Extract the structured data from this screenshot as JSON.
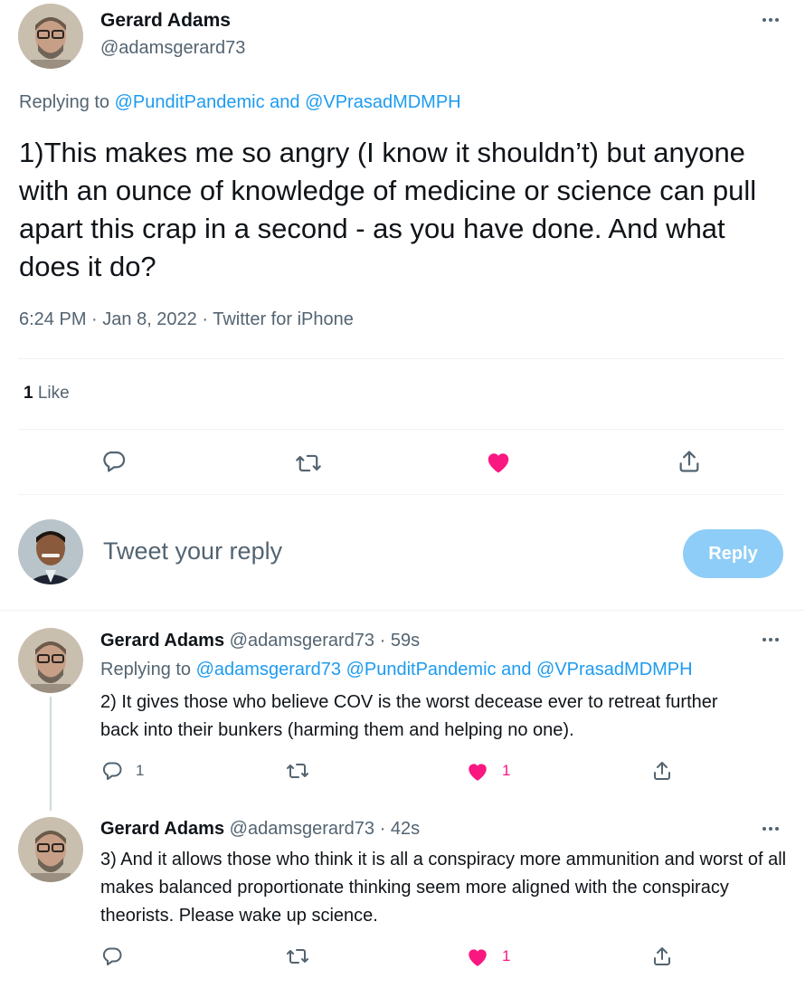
{
  "main_tweet": {
    "author_name": "Gerard Adams",
    "author_handle": "@adamsgerard73",
    "replying_prefix": "Replying to ",
    "replying_to_1": "@PunditPandemic",
    "replying_and": " and ",
    "replying_to_2": "@VPrasadMDMPH",
    "text": "1)This makes me so angry (I know it shouldn’t) but anyone with an ounce of knowledge of medicine or science can pull apart this crap in a second - as you have done. And what does it do?",
    "time": "6:24 PM",
    "sep": " · ",
    "date": "Jan 8, 2022",
    "source": "Twitter for iPhone",
    "likes_count": "1",
    "likes_label": " Like"
  },
  "reply_box": {
    "placeholder": "Tweet your reply",
    "button": "Reply"
  },
  "replies": [
    {
      "author_name": "Gerard Adams",
      "author_handle": "@adamsgerard73",
      "time": "59s",
      "replying_prefix": "Replying to ",
      "replying_to_1": "@adamsgerard73",
      "replying_to_2": "@PunditPandemic",
      "replying_and": " and ",
      "replying_to_3": "@VPrasadMDMPH",
      "text": "2) It gives those who believe COV is the worst decease ever to retreat further back into their bunkers (harming them and helping no one).",
      "reply_count": "1",
      "like_count": "1"
    },
    {
      "author_name": "Gerard Adams",
      "author_handle": "@adamsgerard73",
      "time": "42s",
      "text": "3) And it allows those who think it is all a conspiracy more ammunition and worst of all makes balanced proportionate thinking seem more aligned with the conspiracy theorists. Please wake up science.",
      "like_count": "1"
    }
  ],
  "colors": {
    "accent": "#1d9bf0",
    "like": "#f91880",
    "secondary_text": "#536471",
    "reply_button_disabled": "#8ecdf7"
  },
  "icons": [
    "more-icon",
    "reply-icon",
    "retweet-icon",
    "like-icon",
    "share-icon"
  ]
}
